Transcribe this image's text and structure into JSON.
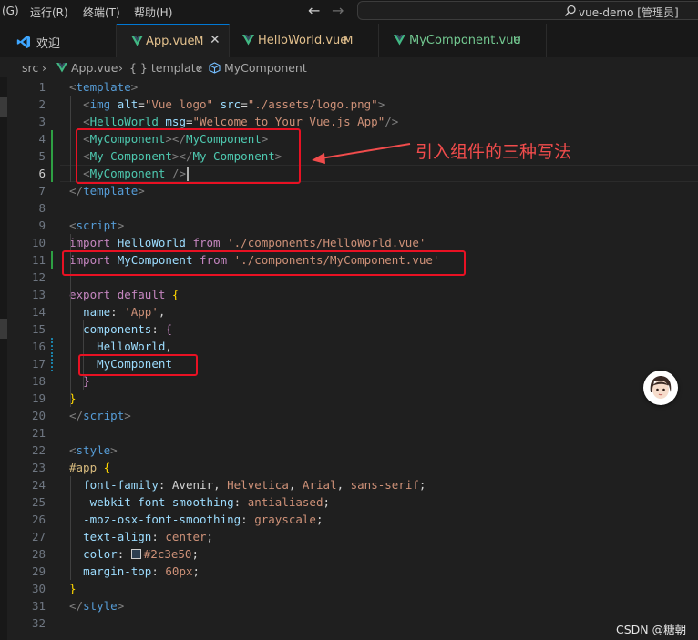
{
  "titlebar": {
    "menus": [
      "(G)",
      "运行(R)",
      "终端(T)",
      "帮助(H)"
    ],
    "search_text": "vue-demo [管理员]"
  },
  "tabs": [
    {
      "label": "欢迎",
      "status": "",
      "icon": "vscode-logo-icon",
      "color": "#cccccc"
    },
    {
      "label": "App.vue",
      "status": "M",
      "icon": "vue-icon",
      "color": "#e2c08d",
      "active": true
    },
    {
      "label": "HelloWorld.vue",
      "status": "M",
      "icon": "vue-icon",
      "color": "#e2c08d"
    },
    {
      "label": "MyComponent.vue",
      "status": "U",
      "icon": "vue-icon",
      "color": "#73c991"
    }
  ],
  "breadcrumb": {
    "items": [
      "src",
      "App.vue",
      "{ } template",
      "MyComponent"
    ]
  },
  "editor": {
    "lines": [
      {
        "n": "1",
        "tokens": [
          [
            "t-tag",
            "<"
          ],
          [
            "t-name",
            "template"
          ],
          [
            "t-tag",
            ">"
          ]
        ]
      },
      {
        "n": "2",
        "tokens": [
          [
            "t-plain",
            "  "
          ],
          [
            "t-tag",
            "<"
          ],
          [
            "t-name",
            "img"
          ],
          [
            "t-plain",
            " "
          ],
          [
            "t-attr",
            "alt"
          ],
          [
            "t-plain",
            "="
          ],
          [
            "t-str",
            "\"Vue logo\""
          ],
          [
            "t-plain",
            " "
          ],
          [
            "t-attr",
            "src"
          ],
          [
            "t-plain",
            "="
          ],
          [
            "t-str",
            "\"./assets/logo.png\""
          ],
          [
            "t-tag",
            ">"
          ]
        ]
      },
      {
        "n": "3",
        "tokens": [
          [
            "t-plain",
            "  "
          ],
          [
            "t-tag",
            "<"
          ],
          [
            "t-comp",
            "HelloWorld"
          ],
          [
            "t-plain",
            " "
          ],
          [
            "t-attr",
            "msg"
          ],
          [
            "t-plain",
            "="
          ],
          [
            "t-str",
            "\"Welcome to Your Vue.js App\""
          ],
          [
            "t-tag",
            "/>"
          ]
        ]
      },
      {
        "n": "4",
        "tokens": [
          [
            "t-plain",
            "  "
          ],
          [
            "t-tag",
            "<"
          ],
          [
            "t-comp",
            "MyComponent"
          ],
          [
            "t-tag",
            "></"
          ],
          [
            "t-comp",
            "MyComponent"
          ],
          [
            "t-tag",
            ">"
          ]
        ]
      },
      {
        "n": "5",
        "tokens": [
          [
            "t-plain",
            "  "
          ],
          [
            "t-tag",
            "<"
          ],
          [
            "t-comp",
            "My-Component"
          ],
          [
            "t-tag",
            "></"
          ],
          [
            "t-comp",
            "My-Component"
          ],
          [
            "t-tag",
            ">"
          ]
        ]
      },
      {
        "n": "6",
        "tokens": [
          [
            "t-plain",
            "  "
          ],
          [
            "t-tag",
            "<"
          ],
          [
            "t-comp",
            "MyComponent"
          ],
          [
            "t-plain",
            " "
          ],
          [
            "t-tag",
            "/>"
          ]
        ]
      },
      {
        "n": "7",
        "tokens": [
          [
            "t-tag",
            "</"
          ],
          [
            "t-name",
            "template"
          ],
          [
            "t-tag",
            ">"
          ]
        ]
      },
      {
        "n": "8",
        "tokens": []
      },
      {
        "n": "9",
        "tokens": [
          [
            "t-tag",
            "<"
          ],
          [
            "t-name",
            "script"
          ],
          [
            "t-tag",
            ">"
          ]
        ]
      },
      {
        "n": "10",
        "tokens": [
          [
            "t-imp",
            "import"
          ],
          [
            "t-plain",
            " "
          ],
          [
            "t-prop",
            "HelloWorld"
          ],
          [
            "t-plain",
            " "
          ],
          [
            "t-imp",
            "from"
          ],
          [
            "t-plain",
            " "
          ],
          [
            "t-str",
            "'./components/HelloWorld.vue'"
          ]
        ]
      },
      {
        "n": "11",
        "tokens": [
          [
            "t-imp",
            "import"
          ],
          [
            "t-plain",
            " "
          ],
          [
            "t-prop",
            "MyComponent"
          ],
          [
            "t-plain",
            " "
          ],
          [
            "t-imp",
            "from"
          ],
          [
            "t-plain",
            " "
          ],
          [
            "t-str",
            "'./components/MyComponent.vue'"
          ]
        ]
      },
      {
        "n": "12",
        "tokens": []
      },
      {
        "n": "13",
        "tokens": [
          [
            "t-imp",
            "export"
          ],
          [
            "t-plain",
            " "
          ],
          [
            "t-imp",
            "default"
          ],
          [
            "t-plain",
            " "
          ],
          [
            "t-brace",
            "{"
          ]
        ]
      },
      {
        "n": "14",
        "tokens": [
          [
            "t-plain",
            "  "
          ],
          [
            "t-prop",
            "name"
          ],
          [
            "t-plain",
            ": "
          ],
          [
            "t-str",
            "'App'"
          ],
          [
            "t-plain",
            ","
          ]
        ]
      },
      {
        "n": "15",
        "tokens": [
          [
            "t-plain",
            "  "
          ],
          [
            "t-prop",
            "components"
          ],
          [
            "t-plain",
            ": "
          ],
          [
            "t-imp",
            "{"
          ]
        ]
      },
      {
        "n": "16",
        "tokens": [
          [
            "t-plain",
            "    "
          ],
          [
            "t-prop",
            "HelloWorld"
          ],
          [
            "t-plain",
            ","
          ]
        ]
      },
      {
        "n": "17",
        "tokens": [
          [
            "t-plain",
            "    "
          ],
          [
            "t-prop",
            "MyComponent"
          ]
        ]
      },
      {
        "n": "18",
        "tokens": [
          [
            "t-plain",
            "  "
          ],
          [
            "t-imp",
            "}"
          ]
        ]
      },
      {
        "n": "19",
        "tokens": [
          [
            "t-brace",
            "}"
          ]
        ]
      },
      {
        "n": "20",
        "tokens": [
          [
            "t-tag",
            "</"
          ],
          [
            "t-name",
            "script"
          ],
          [
            "t-tag",
            ">"
          ]
        ]
      },
      {
        "n": "21",
        "tokens": []
      },
      {
        "n": "22",
        "tokens": [
          [
            "t-tag",
            "<"
          ],
          [
            "t-name",
            "style"
          ],
          [
            "t-tag",
            ">"
          ]
        ]
      },
      {
        "n": "23",
        "tokens": [
          [
            "t-sel",
            "#app"
          ],
          [
            "t-plain",
            " "
          ],
          [
            "t-brace",
            "{"
          ]
        ]
      },
      {
        "n": "24",
        "tokens": [
          [
            "t-plain",
            "  "
          ],
          [
            "t-prop",
            "font-family"
          ],
          [
            "t-plain",
            ": Avenir, "
          ],
          [
            "t-str",
            "Helvetica"
          ],
          [
            "t-plain",
            ", "
          ],
          [
            "t-str",
            "Arial"
          ],
          [
            "t-plain",
            ", "
          ],
          [
            "t-str",
            "sans-serif"
          ],
          [
            "t-plain",
            ";"
          ]
        ]
      },
      {
        "n": "25",
        "tokens": [
          [
            "t-plain",
            "  "
          ],
          [
            "t-prop",
            "-webkit-font-smoothing"
          ],
          [
            "t-plain",
            ": "
          ],
          [
            "t-str",
            "antialiased"
          ],
          [
            "t-plain",
            ";"
          ]
        ]
      },
      {
        "n": "26",
        "tokens": [
          [
            "t-plain",
            "  "
          ],
          [
            "t-prop",
            "-moz-osx-font-smoothing"
          ],
          [
            "t-plain",
            ": "
          ],
          [
            "t-str",
            "grayscale"
          ],
          [
            "t-plain",
            ";"
          ]
        ]
      },
      {
        "n": "27",
        "tokens": [
          [
            "t-plain",
            "  "
          ],
          [
            "t-prop",
            "text-align"
          ],
          [
            "t-plain",
            ": "
          ],
          [
            "t-str",
            "center"
          ],
          [
            "t-plain",
            ";"
          ]
        ]
      },
      {
        "n": "28",
        "tokens": [
          [
            "t-plain",
            "  "
          ],
          [
            "t-prop",
            "color"
          ],
          [
            "t-plain",
            ": "
          ],
          [
            "swatch",
            "#2c3e50"
          ],
          [
            "t-str",
            "#2c3e50"
          ],
          [
            "t-plain",
            ";"
          ]
        ]
      },
      {
        "n": "29",
        "tokens": [
          [
            "t-plain",
            "  "
          ],
          [
            "t-prop",
            "margin-top"
          ],
          [
            "t-plain",
            ": "
          ],
          [
            "t-str",
            "60px"
          ],
          [
            "t-plain",
            ";"
          ]
        ]
      },
      {
        "n": "30",
        "tokens": [
          [
            "t-brace",
            "}"
          ]
        ]
      },
      {
        "n": "31",
        "tokens": [
          [
            "t-tag",
            "</"
          ],
          [
            "t-name",
            "style"
          ],
          [
            "t-tag",
            ">"
          ]
        ]
      },
      {
        "n": "32",
        "tokens": []
      }
    ],
    "current_line": 6,
    "modified_lines": [
      4,
      5,
      6,
      11
    ],
    "changed_lines": [
      16,
      17
    ]
  },
  "annotation": "引入组件的三种写法",
  "watermark": "CSDN @糖朝",
  "colors": {
    "accent": "#0078d4",
    "annotation": "#f14c4c",
    "added": "#2ea043",
    "changed": "#1b81a8"
  }
}
